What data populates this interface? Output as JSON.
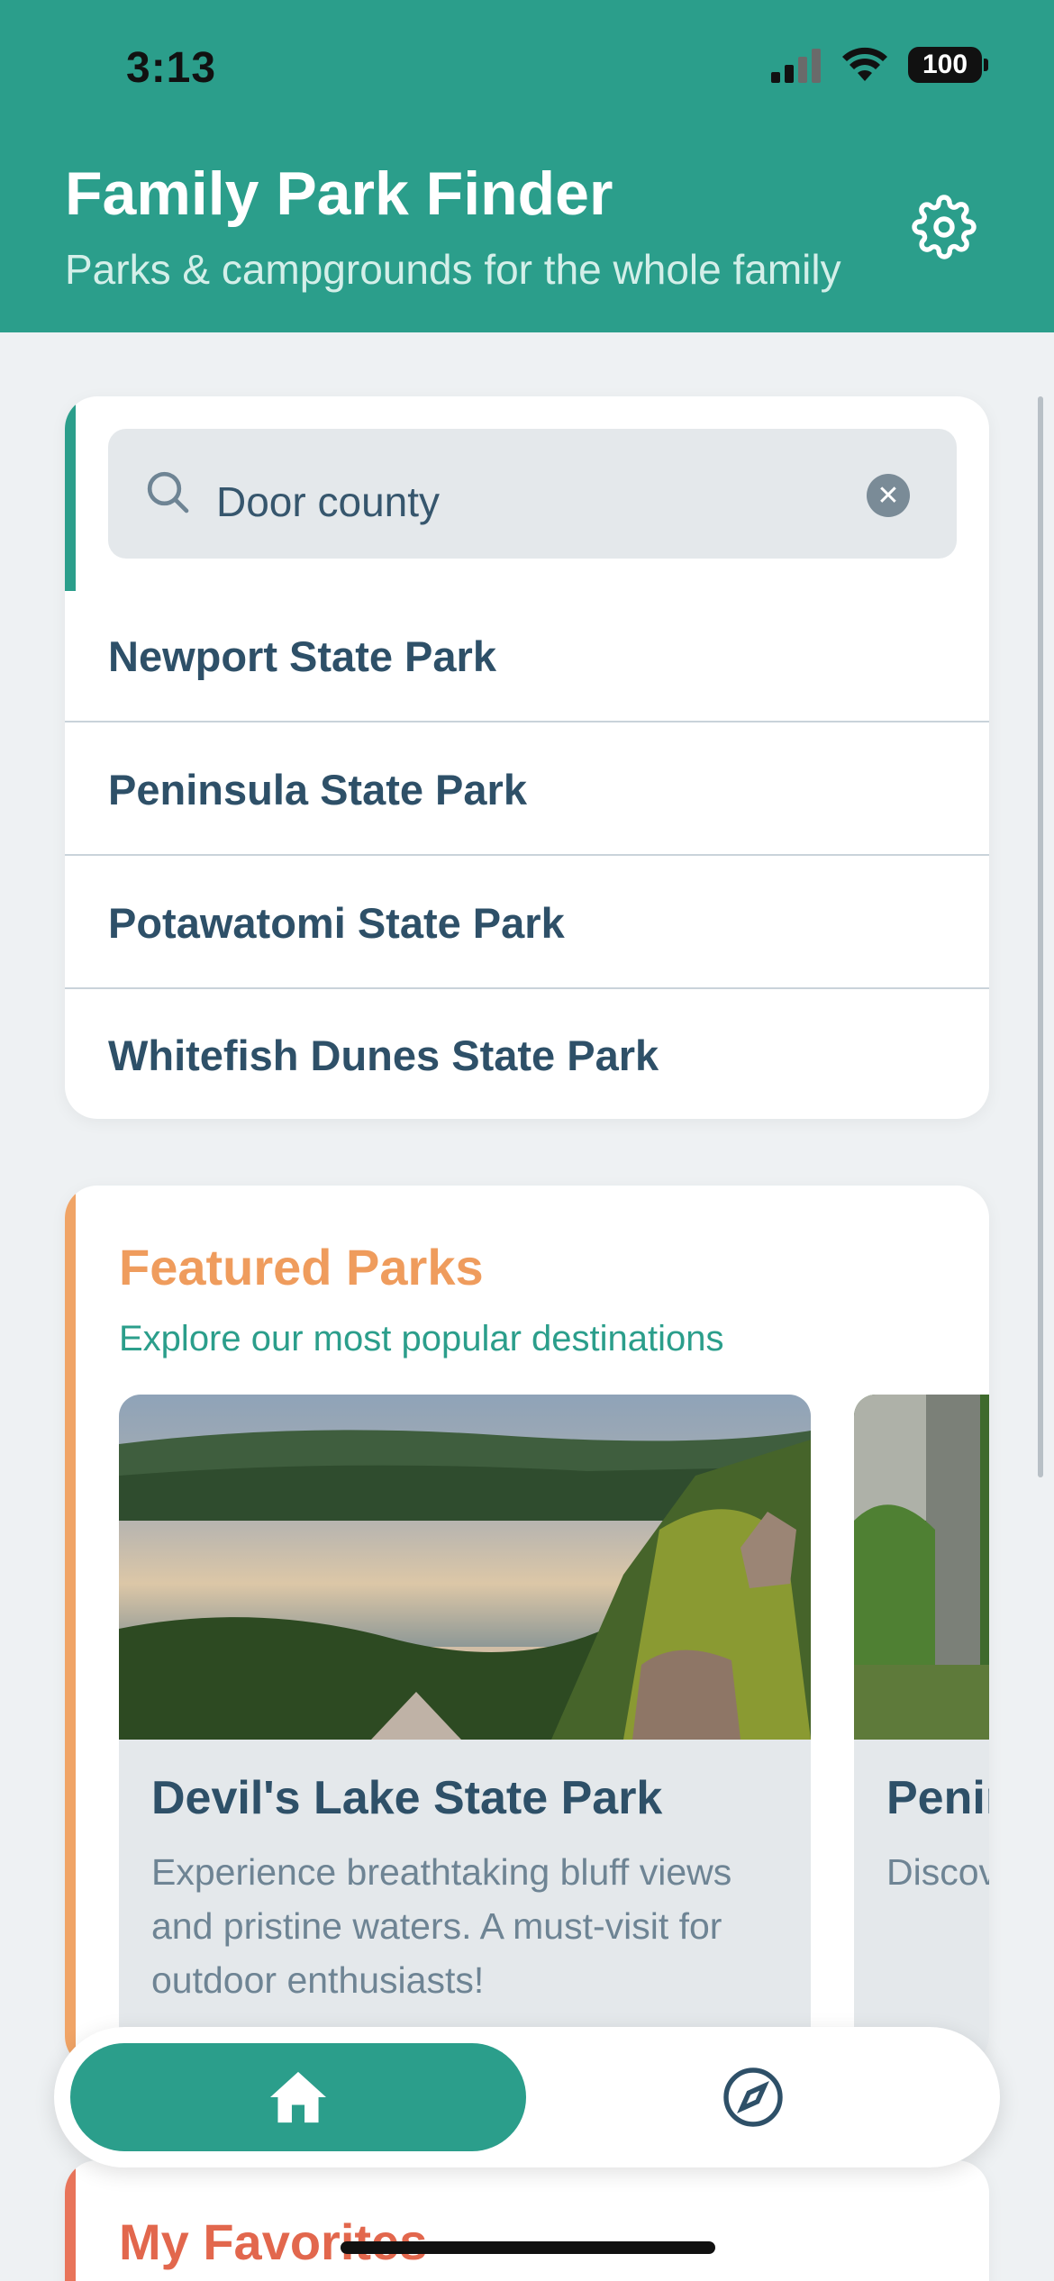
{
  "status_bar": {
    "time": "3:13",
    "battery": "100"
  },
  "header": {
    "title": "Family Park Finder",
    "subtitle": "Parks & campgrounds for the whole family",
    "settings_icon": "gear-icon"
  },
  "search": {
    "value": "Door county",
    "icon": "search-icon",
    "clear_icon": "close-icon",
    "results": [
      {
        "label": "Newport State Park"
      },
      {
        "label": "Peninsula State Park"
      },
      {
        "label": "Potawatomi State Park"
      },
      {
        "label": "Whitefish Dunes State Park"
      }
    ]
  },
  "featured": {
    "title": "Featured Parks",
    "subtitle": "Explore our most popular destinations",
    "parks": [
      {
        "name": "Devil's Lake State Park",
        "description": "Experience breathtaking bluff views and pristine waters. A must-visit for outdoor enthusiasts!"
      },
      {
        "name": "Peninsula State Park",
        "description": "Discover stunning ... and ev..."
      }
    ]
  },
  "nav": {
    "items": [
      {
        "icon": "home-icon",
        "active": true
      },
      {
        "icon": "compass-icon",
        "active": false
      }
    ]
  },
  "favorites": {
    "title": "My Favorites"
  },
  "colors": {
    "primary": "#2b9e8b",
    "featured_accent": "#f0a466",
    "favorites_accent": "#e8745a",
    "text_dark": "#2e5068"
  }
}
